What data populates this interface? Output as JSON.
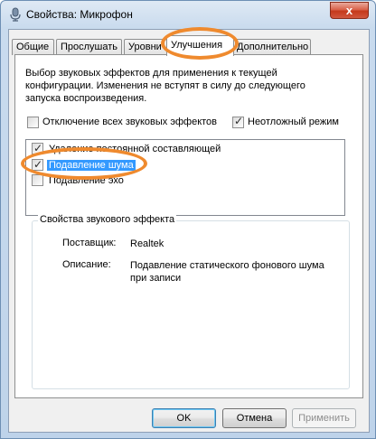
{
  "window": {
    "title": "Свойства: Микрофон",
    "close_glyph": "x"
  },
  "tabs": [
    {
      "label": "Общие"
    },
    {
      "label": "Прослушать"
    },
    {
      "label": "Уровни"
    },
    {
      "label": "Улучшения"
    },
    {
      "label": "Дополнительно"
    }
  ],
  "active_tab": "Улучшения",
  "enhancements": {
    "description_lines": [
      "Выбор звуковых эффектов для применения к текущей",
      "конфигурации. Изменения не вступят в силу до следующего",
      "запуска воспроизведения."
    ],
    "disable_all_label": "Отключение всех звуковых эффектов",
    "disable_all_checked": false,
    "immediate_mode_label": "Неотложный режим",
    "immediate_mode_checked": true,
    "effects": [
      {
        "label": "Удаление постоянной составляющей",
        "checked": true
      },
      {
        "label": "Подавление шума",
        "checked": true,
        "selected": true
      },
      {
        "label": "Подавление эхо",
        "checked": false
      }
    ],
    "properties": {
      "group_title": "Свойства звукового эффекта",
      "provider_label": "Поставщик:",
      "provider_value": "Realtek",
      "description_label": "Описание:",
      "description_value": "Подавление статического фонового шума при записи"
    }
  },
  "buttons": {
    "ok": "OK",
    "cancel": "Отмена",
    "apply": "Применить"
  },
  "colors": {
    "highlight_ring": "#ef8a2e",
    "selection": "#3399ff"
  },
  "icons": {
    "title": "microphone-icon"
  }
}
